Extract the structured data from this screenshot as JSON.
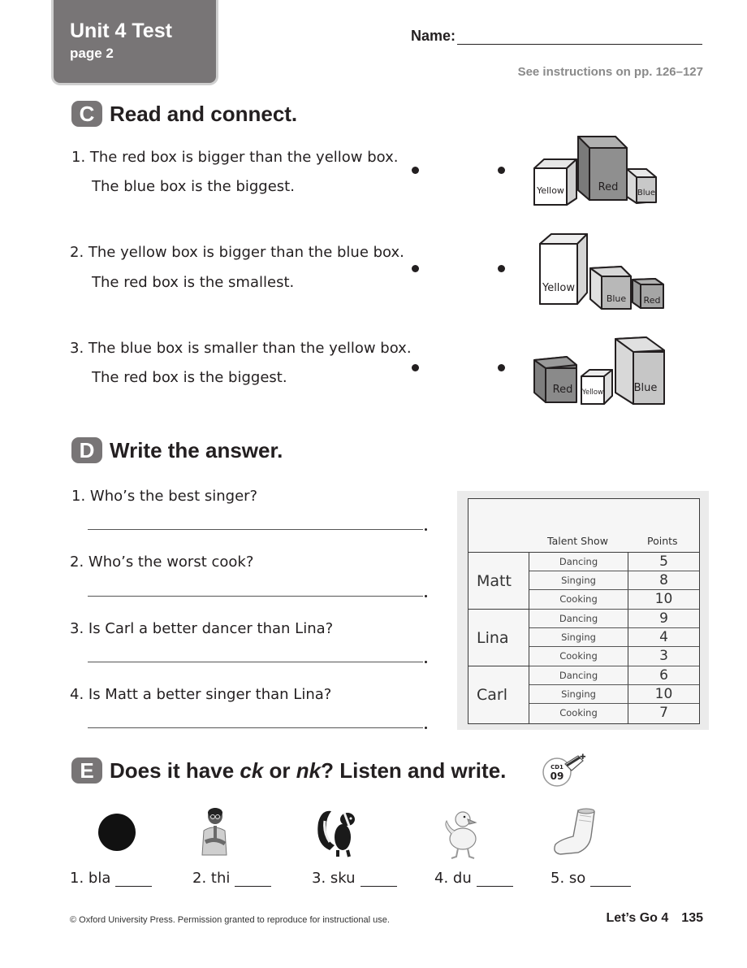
{
  "header": {
    "unit_title": "Unit 4 Test",
    "unit_page": "page 2",
    "name_label": "Name:",
    "instructions": "See instructions on pp. 126–127"
  },
  "section_c": {
    "badge": "C",
    "title": "Read and connect.",
    "items": [
      {
        "line1": "1. The red box is bigger than the yellow box.",
        "line2": "The blue box is the biggest."
      },
      {
        "line1": "2. The yellow box is bigger than the blue box.",
        "line2": "The red box is the smallest."
      },
      {
        "line1": "3. The blue box is smaller than the yellow box.",
        "line2": "The red box is the biggest."
      }
    ],
    "pictures": [
      {
        "labels": [
          "Yellow",
          "Red",
          "Blue"
        ]
      },
      {
        "labels": [
          "Yellow",
          "Blue",
          "Red"
        ]
      },
      {
        "labels": [
          "Red",
          "Yellow",
          "Blue"
        ]
      }
    ]
  },
  "section_d": {
    "badge": "D",
    "title": "Write the answer.",
    "questions": [
      "1. Who’s the best singer?",
      "2. Who’s the worst cook?",
      "3. Is Carl a better dancer than Lina?",
      "4. Is Matt a better singer than Lina?"
    ],
    "table": {
      "header_activity": "Talent Show",
      "header_points": "Points",
      "people": [
        {
          "name": "Matt",
          "rows": [
            {
              "activity": "Dancing",
              "points": "5"
            },
            {
              "activity": "Singing",
              "points": "8"
            },
            {
              "activity": "Cooking",
              "points": "10"
            }
          ]
        },
        {
          "name": "Lina",
          "rows": [
            {
              "activity": "Dancing",
              "points": "9"
            },
            {
              "activity": "Singing",
              "points": "4"
            },
            {
              "activity": "Cooking",
              "points": "3"
            }
          ]
        },
        {
          "name": "Carl",
          "rows": [
            {
              "activity": "Dancing",
              "points": "6"
            },
            {
              "activity": "Singing",
              "points": "10"
            },
            {
              "activity": "Cooking",
              "points": "7"
            }
          ]
        }
      ]
    }
  },
  "section_e": {
    "badge": "E",
    "title_pre": "Does it have ",
    "title_ck": "ck",
    "title_or": " or ",
    "title_nk": "nk",
    "title_post": "? Listen and write.",
    "cd_label": "CD1",
    "cd_track": "09",
    "items": [
      {
        "label": "1. bla",
        "picture": "black-circle"
      },
      {
        "label": "2. thi",
        "picture": "boy-thinking"
      },
      {
        "label": "3. sku",
        "picture": "skunk"
      },
      {
        "label": "4. du",
        "picture": "duck"
      },
      {
        "label": "5. so",
        "picture": "sock"
      }
    ]
  },
  "footer": {
    "copyright": "© Oxford University Press. Permission granted to reproduce for instructional use.",
    "book": "Let’s Go 4",
    "page_number": "135"
  }
}
